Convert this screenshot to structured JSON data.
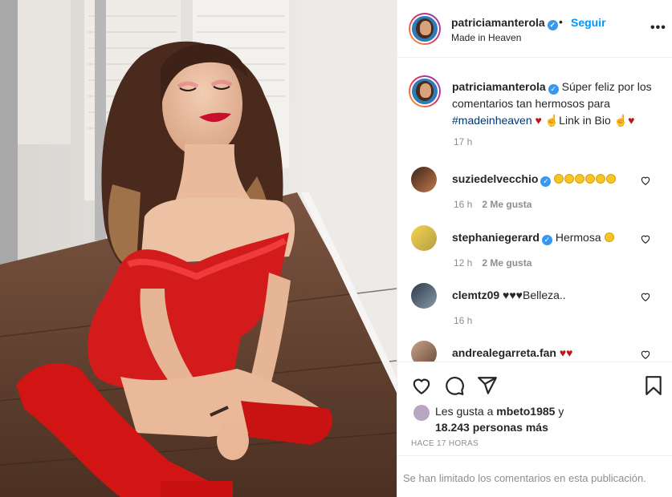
{
  "post": {
    "username": "patriciamanterola",
    "follow_label": "Seguir",
    "location": "Made in Heaven",
    "more_label": "•••",
    "dot": "•"
  },
  "caption": {
    "username": "patriciamanterola",
    "text_before": "Súper feliz por los comentarios tan hermosos para",
    "hashtag": "#madeinheaven",
    "text_after": "Link in Bio",
    "time": "17 h"
  },
  "comments": [
    {
      "username": "suziedelvecchio",
      "text": "",
      "emoji_count": 6,
      "time": "16 h",
      "likes": "2 Me gusta",
      "verified": true
    },
    {
      "username": "stephaniegerard",
      "text": "Hermosa",
      "emoji_count": 1,
      "time": "12 h",
      "likes": "2 Me gusta",
      "verified": true
    },
    {
      "username": "clemtz09",
      "text": "Belleza..",
      "time": "16 h",
      "likes": ""
    },
    {
      "username": "andrealegarreta.fan",
      "text": "",
      "time": "",
      "likes": ""
    }
  ],
  "actions": {
    "liked_by_prefix": "Les gusta a",
    "liked_by_user": "mbeto1985",
    "liked_by_mid": "y",
    "others_count": "18.243 personas más",
    "timestamp": "HACE 17 HORAS",
    "limited_text": "Se han limitado los comentarios en esta publicación."
  },
  "colors": {
    "link_blue": "#0095f6",
    "verified_blue": "#3897f0",
    "hashtag": "#00376b",
    "dress_red": "#d41b1b",
    "muted": "#8e8e8e"
  },
  "icons": {
    "like": "heart-icon",
    "comment": "comment-icon",
    "share": "paper-plane-icon",
    "save": "bookmark-icon",
    "verified": "verified-badge-icon"
  }
}
